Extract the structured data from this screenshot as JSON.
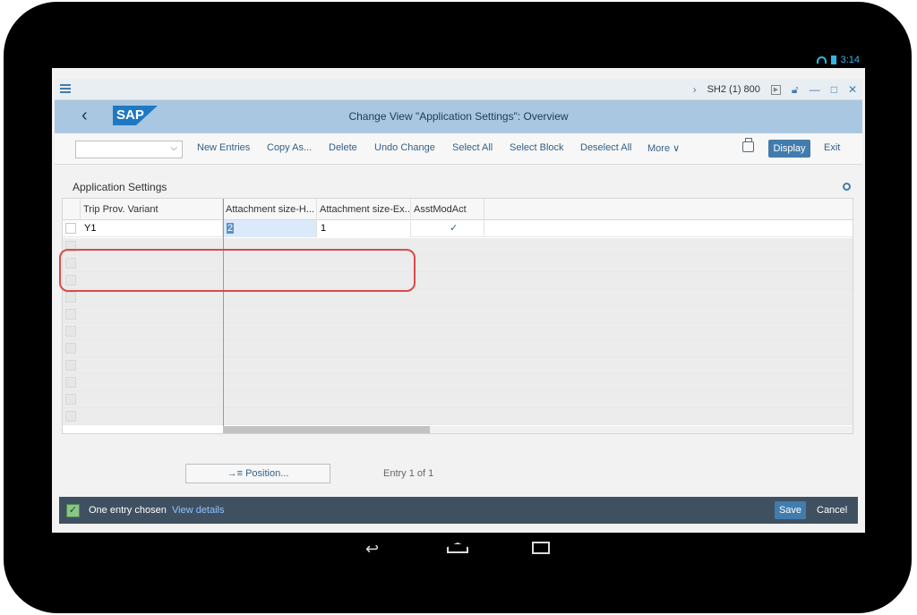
{
  "status_bar": {
    "time": "3:14"
  },
  "title_bar": {
    "system": "SH2 (1) 800"
  },
  "shell": {
    "logo": "SAP",
    "title": "Change View \"Application Settings\": Overview"
  },
  "toolbar": {
    "select_value": "",
    "new_entries": "New Entries",
    "copy_as": "Copy As...",
    "delete": "Delete",
    "undo_change": "Undo Change",
    "select_all": "Select All",
    "select_block": "Select Block",
    "deselect_all": "Deselect All",
    "more": "More",
    "display": "Display",
    "exit": "Exit"
  },
  "section": {
    "title": "Application Settings"
  },
  "table": {
    "columns": [
      "Trip Prov. Variant",
      "Attachment size-H...",
      "Attachment size-Ex...",
      "AsstModAct"
    ],
    "rows": [
      {
        "variant": "Y1",
        "size_h": "2",
        "size_ex": "1",
        "asst_mod_act": true
      }
    ]
  },
  "position_button": "Position...",
  "entry_count": "Entry 1 of 1",
  "footer": {
    "message": "One entry chosen",
    "link": "View details",
    "save": "Save",
    "cancel": "Cancel"
  },
  "colors": {
    "accent": "#427cac",
    "shell": "#a9c7e1",
    "footer": "#3f5161",
    "highlight": "#d94a4a"
  }
}
